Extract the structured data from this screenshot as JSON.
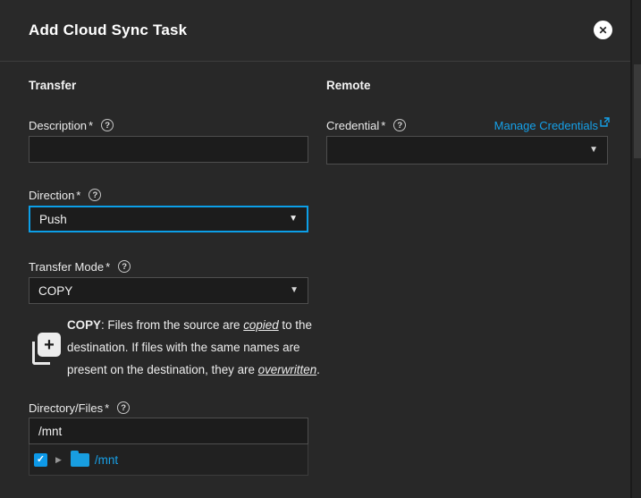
{
  "dialog": {
    "title": "Add Cloud Sync Task"
  },
  "icons": {
    "close": "✕",
    "help": "?",
    "caret_down": "▼",
    "expander_collapsed": "▶",
    "check": "✓",
    "plus": "+"
  },
  "colors": {
    "accent_blue": "#0c9fe8",
    "link_blue": "#15a0e8",
    "folder_blue": "#189ee0",
    "dialog_bg": "#282828",
    "input_bg": "#1c1c1c"
  },
  "transfer": {
    "section_label": "Transfer",
    "description": {
      "label": "Description",
      "required": "*",
      "value": ""
    },
    "direction": {
      "label": "Direction",
      "required": "*",
      "value": "Push"
    },
    "transfer_mode": {
      "label": "Transfer Mode",
      "required": "*",
      "value": "COPY"
    },
    "copy_info": {
      "term": "COPY",
      "line1_rest": ": Files from the source are ",
      "line1_em": "copied",
      "line1_end": " to the",
      "line2": "destination. If files with the same names are",
      "line3_pre": "present on the destination, they are ",
      "line3_em": "overwritten",
      "line3_end": "."
    },
    "directory": {
      "label": "Directory/Files",
      "required": "*",
      "value": "/mnt"
    },
    "tree": {
      "node_label": "/mnt",
      "checked": true
    }
  },
  "remote": {
    "section_label": "Remote",
    "credential": {
      "label": "Credential",
      "required": "*",
      "value": "",
      "link_label": "Manage Credentials"
    }
  }
}
